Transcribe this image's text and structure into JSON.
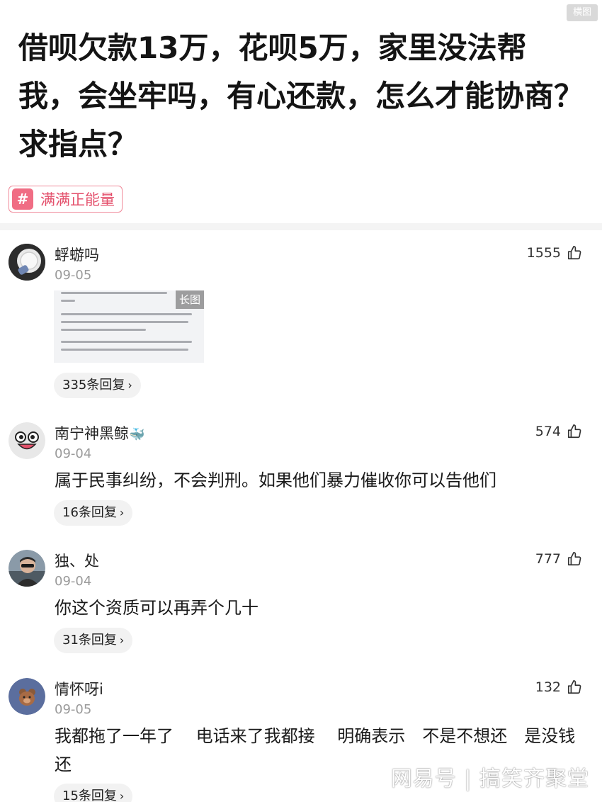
{
  "corner_badge": "横图",
  "post": {
    "title": "借呗欠款13万，花呗5万，家里没法帮我，会坐牢吗，有心还款，怎么才能协商？求指点？",
    "topic_tag": "满满正能量"
  },
  "colors": {
    "tag_accent": "#f06d84",
    "date_gray": "#9a9a9a",
    "reply_pill_bg": "#f2f2f2"
  },
  "comments": [
    {
      "username": "蜉蝣吗",
      "date": "09-05",
      "likes": "1555",
      "image_badge": "长图",
      "replies": "335条回复",
      "avatar_icon": "fan-avatar-icon"
    },
    {
      "username": "南宁神黑鲸",
      "username_emoji": "🐳",
      "date": "09-04",
      "likes": "574",
      "text": "属于民事纠纷，不会判刑。如果他们暴力催收你可以告他们",
      "replies": "16条回复",
      "avatar_icon": "cartoon-face-avatar-icon"
    },
    {
      "username": "独、处",
      "date": "09-04",
      "likes": "777",
      "text": "你这个资质可以再弄个几十",
      "replies": "31条回复",
      "avatar_icon": "person-sunglasses-avatar-icon"
    },
    {
      "username": "情怀呀i",
      "date": "09-05",
      "likes": "132",
      "text": "我都拖了一年了　 电话来了我都接　 明确表示　不是不想还　是没钱还",
      "replies": "15条回复",
      "avatar_icon": "teddy-bear-avatar-icon"
    }
  ],
  "watermark": "网易号 | 搞笑齐聚堂"
}
